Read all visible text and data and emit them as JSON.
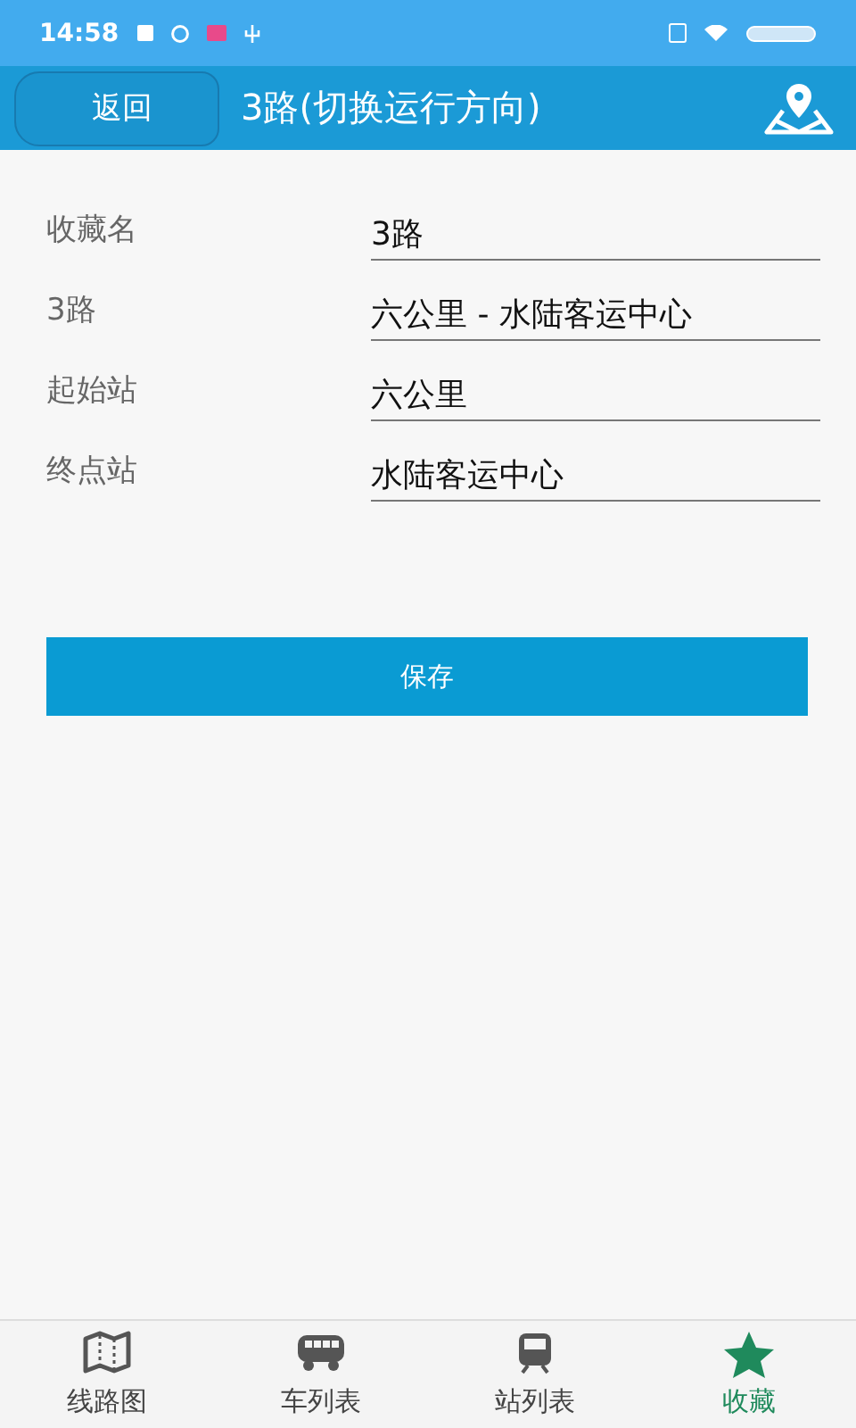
{
  "status_bar": {
    "time": "14:58"
  },
  "header": {
    "back": "返回",
    "title": "3路(切换运行方向)"
  },
  "form": {
    "fields": [
      {
        "label": "收藏名",
        "value": "3路"
      },
      {
        "label": "3路",
        "value": "六公里 - 水陆客运中心"
      },
      {
        "label": "起始站",
        "value": "六公里"
      },
      {
        "label": "终点站",
        "value": "水陆客运中心"
      }
    ]
  },
  "save_button": "保存",
  "tabs": [
    {
      "label": "线路图",
      "kind": "map",
      "selected": false
    },
    {
      "label": "车列表",
      "kind": "bus",
      "selected": false
    },
    {
      "label": "站列表",
      "kind": "station",
      "selected": false
    },
    {
      "label": "收藏",
      "kind": "star",
      "selected": true
    }
  ]
}
